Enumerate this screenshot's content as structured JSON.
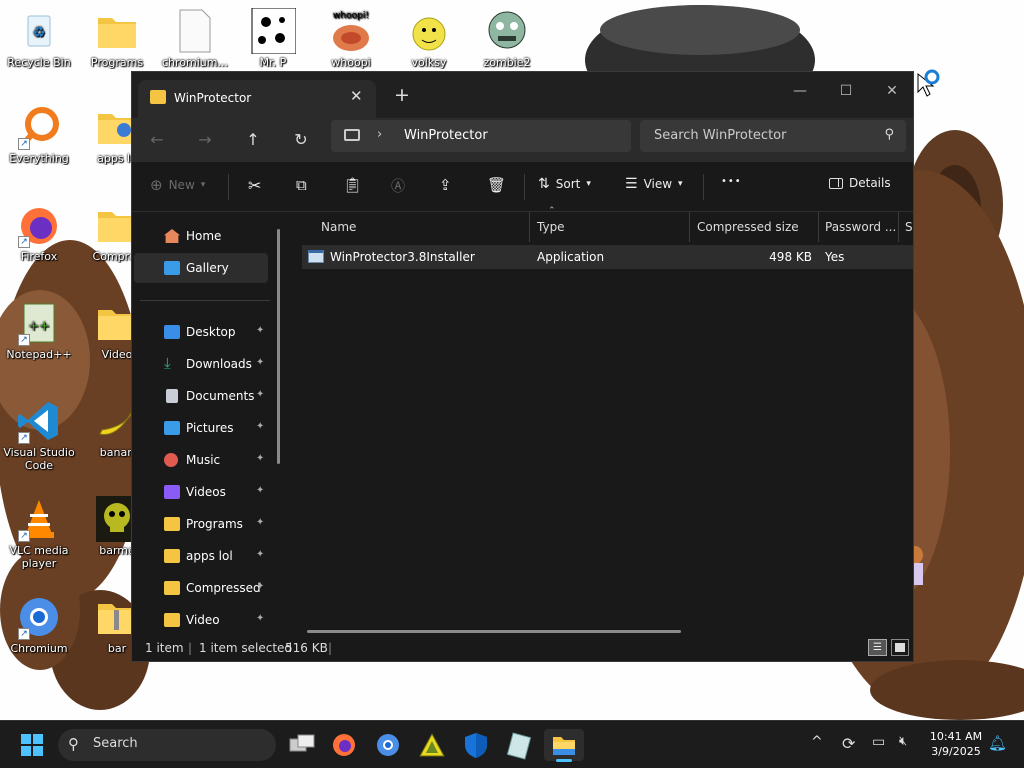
{
  "desktop": {
    "icons": [
      {
        "label": "Recycle Bin",
        "icon": "recycle-bin-icon"
      },
      {
        "label": "Programs",
        "icon": "folder-icon"
      },
      {
        "label": "chromium...",
        "icon": "file-icon"
      },
      {
        "label": "Mr. P",
        "icon": "paw-print-icon"
      },
      {
        "label": "whoopi",
        "icon": "whoopi-icon"
      },
      {
        "label": "volksy",
        "icon": "volksy-icon"
      },
      {
        "label": "zombie2",
        "icon": "zombie-icon"
      },
      {
        "label": "Everything",
        "icon": "everything-search-icon"
      },
      {
        "label": "apps lo",
        "icon": "folder-icon"
      },
      {
        "label": "Firefox",
        "icon": "firefox-icon"
      },
      {
        "label": "Compres",
        "icon": "folder-icon"
      },
      {
        "label": "Notepad++",
        "icon": "notepad-plus-plus-icon"
      },
      {
        "label": "Video",
        "icon": "folder-icon"
      },
      {
        "label": "Visual Studio Code",
        "icon": "vscode-icon"
      },
      {
        "label": "banan",
        "icon": "banana-icon"
      },
      {
        "label": "VLC media player",
        "icon": "vlc-icon"
      },
      {
        "label": "barme",
        "icon": "skull-icon"
      },
      {
        "label": "Chromium",
        "icon": "chromium-icon"
      },
      {
        "label": "bar",
        "icon": "zip-folder-icon"
      }
    ],
    "whoopi_text": "whoopi!"
  },
  "explorer": {
    "tab_title": "WinProtector",
    "close_tab": "✕",
    "new_tab": "+",
    "window_controls": {
      "minimize": "—",
      "maximize": "☐",
      "close": "✕"
    },
    "nav": {
      "back": "←",
      "forward": "→",
      "up": "↑",
      "refresh": "↻"
    },
    "address": {
      "chevron": "›",
      "path": "WinProtector"
    },
    "search_placeholder": "Search WinProtector",
    "commands": {
      "new": "New",
      "sort": "Sort",
      "view": "View",
      "more": "•••",
      "details": "Details"
    },
    "sidebar": {
      "home": "Home",
      "gallery": "Gallery",
      "items": [
        {
          "label": "Desktop",
          "icon": "desktop-icon",
          "color": "#3a8ee6"
        },
        {
          "label": "Downloads",
          "icon": "download-icon",
          "color": "#2fb67c"
        },
        {
          "label": "Documents",
          "icon": "document-icon",
          "color": "#c9ced6"
        },
        {
          "label": "Pictures",
          "icon": "pictures-icon",
          "color": "#3a9be6"
        },
        {
          "label": "Music",
          "icon": "music-icon",
          "color": "#e05a4f"
        },
        {
          "label": "Videos",
          "icon": "videos-icon",
          "color": "#8a5cf6"
        },
        {
          "label": "Programs",
          "icon": "folder-icon",
          "color": "#f4c542"
        },
        {
          "label": "apps lol",
          "icon": "folder-icon",
          "color": "#f4c542"
        },
        {
          "label": "Compressed",
          "icon": "folder-icon",
          "color": "#f4c542"
        },
        {
          "label": "Video",
          "icon": "folder-icon",
          "color": "#f4c542"
        }
      ],
      "pin": "📌"
    },
    "columns": {
      "name": "Name",
      "type": "Type",
      "compressed_size": "Compressed size",
      "password": "Password ...",
      "size": "Si"
    },
    "files": [
      {
        "name": "WinProtector3.8Installer",
        "type": "Application",
        "compressed_size": "498 KB",
        "password": "Yes"
      }
    ],
    "status": {
      "count": "1 item",
      "selected": "1 item selected",
      "size": "516 KB"
    }
  },
  "taskbar": {
    "search_label": "Search",
    "time": "10:41 AM",
    "date": "3/9/2025",
    "tray_chevron": "^"
  },
  "colors": {
    "window_bg": "#191919",
    "taskbar_bg": "#1c1c1c",
    "accent": "#0078d4",
    "folder": "#f4c542"
  }
}
